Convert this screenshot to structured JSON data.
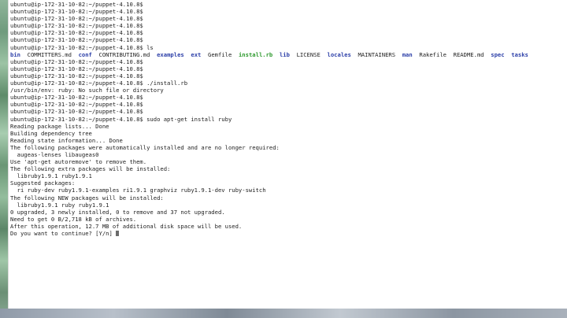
{
  "terminal": {
    "lines": [
      {
        "text": "ubuntu@ip-172-31-10-82:~/puppet-4.10.8$"
      },
      {
        "text": "ubuntu@ip-172-31-10-82:~/puppet-4.10.8$"
      },
      {
        "text": "ubuntu@ip-172-31-10-82:~/puppet-4.10.8$"
      },
      {
        "text": "ubuntu@ip-172-31-10-82:~/puppet-4.10.8$"
      },
      {
        "text": "ubuntu@ip-172-31-10-82:~/puppet-4.10.8$"
      },
      {
        "text": "ubuntu@ip-172-31-10-82:~/puppet-4.10.8$"
      },
      {
        "text": "ubuntu@ip-172-31-10-82:~/puppet-4.10.8$ ls"
      },
      {
        "type": "ls"
      },
      {
        "text": "ubuntu@ip-172-31-10-82:~/puppet-4.10.8$"
      },
      {
        "text": "ubuntu@ip-172-31-10-82:~/puppet-4.10.8$"
      },
      {
        "text": "ubuntu@ip-172-31-10-82:~/puppet-4.10.8$"
      },
      {
        "text": "ubuntu@ip-172-31-10-82:~/puppet-4.10.8$ ./install.rb"
      },
      {
        "text": "/usr/bin/env: ruby: No such file or directory"
      },
      {
        "text": "ubuntu@ip-172-31-10-82:~/puppet-4.10.8$"
      },
      {
        "text": "ubuntu@ip-172-31-10-82:~/puppet-4.10.8$"
      },
      {
        "text": "ubuntu@ip-172-31-10-82:~/puppet-4.10.8$"
      },
      {
        "text": "ubuntu@ip-172-31-10-82:~/puppet-4.10.8$ sudo apt-get install ruby"
      },
      {
        "text": "Reading package lists... Done"
      },
      {
        "text": "Building dependency tree"
      },
      {
        "text": "Reading state information... Done"
      },
      {
        "text": "The following packages were automatically installed and are no longer required:"
      },
      {
        "text": "  augeas-lenses libaugeas0"
      },
      {
        "text": "Use 'apt-get autoremove' to remove them."
      },
      {
        "text": "The following extra packages will be installed:"
      },
      {
        "text": "  libruby1.9.1 ruby1.9.1"
      },
      {
        "text": "Suggested packages:"
      },
      {
        "text": "  ri ruby-dev ruby1.9.1-examples ri1.9.1 graphviz ruby1.9.1-dev ruby-switch"
      },
      {
        "text": "The following NEW packages will be installed:"
      },
      {
        "text": "  libruby1.9.1 ruby ruby1.9.1"
      },
      {
        "text": "0 upgraded, 3 newly installed, 0 to remove and 37 not upgraded."
      },
      {
        "text": "Need to get 0 B/2,718 kB of archives."
      },
      {
        "text": "After this operation, 12.7 MB of additional disk space will be used."
      },
      {
        "text": "Do you want to continue? [Y/n] ",
        "cursor": true
      }
    ],
    "ls_entries": [
      {
        "name": "bin",
        "kind": "dir",
        "after": "  "
      },
      {
        "name": "COMMITTERS.md",
        "kind": "file",
        "after": "  "
      },
      {
        "name": "conf",
        "kind": "dir",
        "after": "  "
      },
      {
        "name": "CONTRIBUTING.md",
        "kind": "file",
        "after": "  "
      },
      {
        "name": "examples",
        "kind": "dir",
        "after": "  "
      },
      {
        "name": "ext",
        "kind": "dir",
        "after": "  "
      },
      {
        "name": "Gemfile",
        "kind": "file",
        "after": "  "
      },
      {
        "name": "install.rb",
        "kind": "exe",
        "after": "  "
      },
      {
        "name": "lib",
        "kind": "dir",
        "after": "  "
      },
      {
        "name": "LICENSE",
        "kind": "file",
        "after": "  "
      },
      {
        "name": "locales",
        "kind": "dir",
        "after": "  "
      },
      {
        "name": "MAINTAINERS",
        "kind": "file",
        "after": "  "
      },
      {
        "name": "man",
        "kind": "dir",
        "after": "  "
      },
      {
        "name": "Rakefile",
        "kind": "file",
        "after": "  "
      },
      {
        "name": "README.md",
        "kind": "file",
        "after": "  "
      },
      {
        "name": "spec",
        "kind": "dir",
        "after": "  "
      },
      {
        "name": "tasks",
        "kind": "dir",
        "after": ""
      }
    ]
  },
  "colors": {
    "text": "#1e1e1e",
    "directory": "#2c3fa8",
    "executable": "#2e9a2e",
    "background": "#ffffff"
  }
}
